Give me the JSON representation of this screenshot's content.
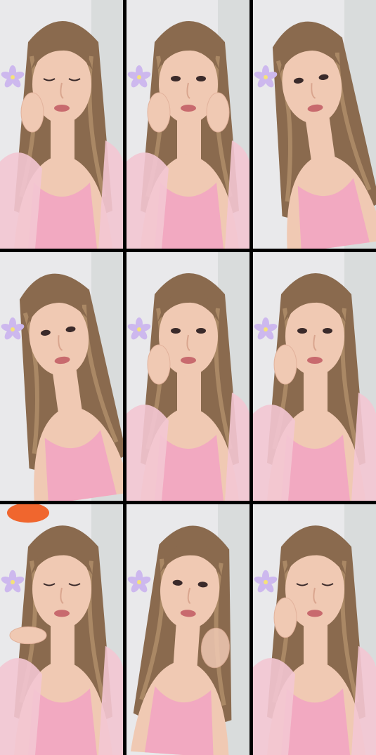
{
  "grid": {
    "rows": 3,
    "columns": 3,
    "tiles": [
      {
        "pose": "hand-on-cheek-left",
        "eyes": "closed",
        "flower": true,
        "lace_sleeve": true,
        "sticker": false
      },
      {
        "pose": "both-hands-on-cheeks",
        "eyes": "open",
        "flower": true,
        "lace_sleeve": true,
        "sticker": false
      },
      {
        "pose": "head-tilt",
        "eyes": "open",
        "flower": true,
        "lace_sleeve": false,
        "sticker": false
      },
      {
        "pose": "head-tilt",
        "eyes": "open",
        "flower": true,
        "lace_sleeve": false,
        "sticker": false
      },
      {
        "pose": "hand-on-cheek-left",
        "eyes": "open",
        "flower": true,
        "lace_sleeve": true,
        "sticker": false
      },
      {
        "pose": "hand-on-cheek-left",
        "eyes": "open",
        "flower": true,
        "lace_sleeve": true,
        "sticker": false
      },
      {
        "pose": "hand-at-chin",
        "eyes": "closed",
        "flower": true,
        "lace_sleeve": true,
        "sticker": true
      },
      {
        "pose": "hand-raised",
        "eyes": "open",
        "flower": true,
        "lace_sleeve": false,
        "sticker": false
      },
      {
        "pose": "hand-on-cheek-left",
        "eyes": "closed",
        "flower": true,
        "lace_sleeve": true,
        "sticker": false
      }
    ]
  },
  "colors": {
    "gap": "#000000",
    "background_wall": "#e9e9eb",
    "hair": "#8a6a4e",
    "hair_highlight": "#b8956f",
    "skin": "#f0c9b3",
    "top": "#f2a9c1",
    "lace": "#f3c6d3",
    "lips": "#c86a6e",
    "flower": "#cdb8ee",
    "sticker": "#f0662e"
  }
}
